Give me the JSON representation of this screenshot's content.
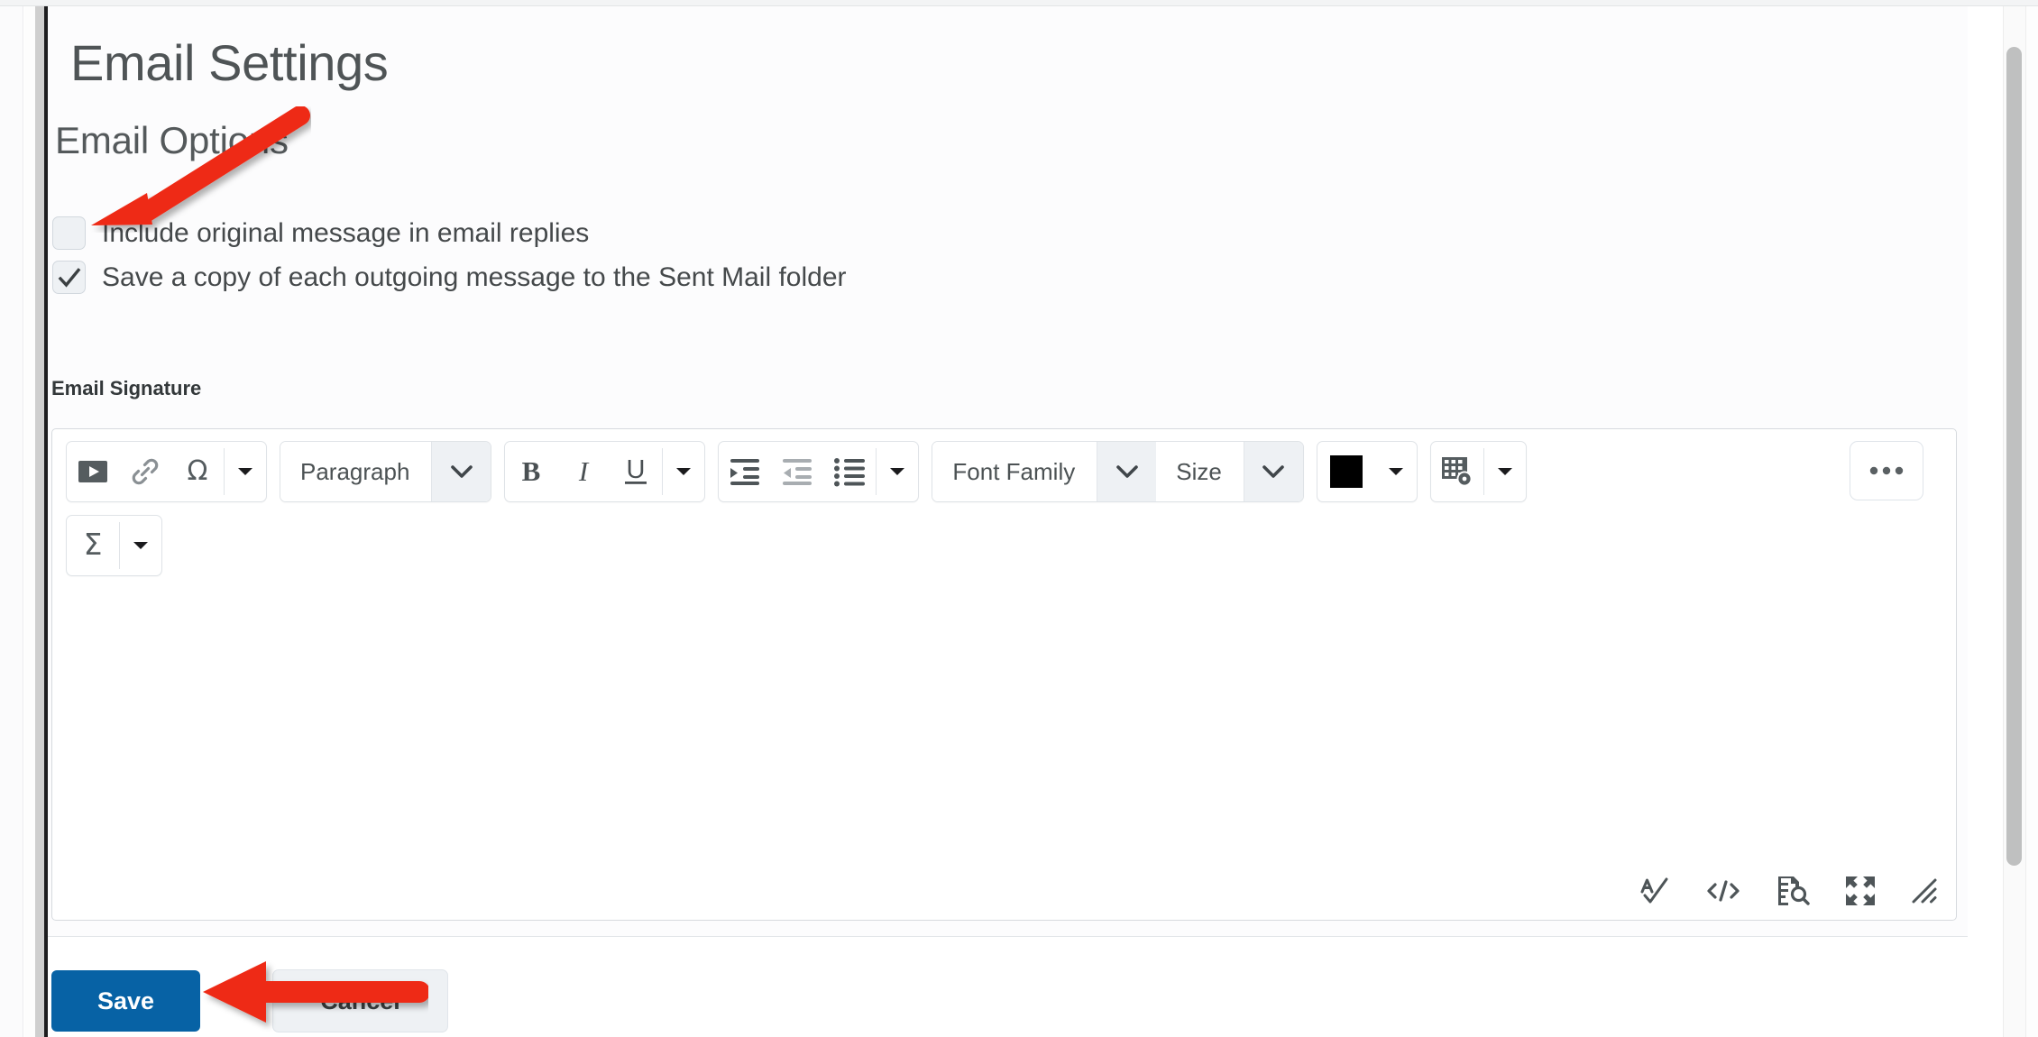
{
  "page": {
    "title": "Email Settings",
    "section_heading": "Email Options"
  },
  "options": [
    {
      "label": "Include original message in email replies",
      "checked": false,
      "name": "include-original-message"
    },
    {
      "label": "Save a copy of each outgoing message to the Sent Mail folder",
      "checked": true,
      "name": "save-copy-sent-mail"
    }
  ],
  "signature": {
    "field_label": "Email Signature",
    "body_text": ""
  },
  "toolbar": {
    "groups": [
      {
        "name": "insert-group",
        "items": [
          {
            "name": "insert-stuff-icon",
            "type": "icon",
            "icon": "insert-stuff"
          },
          {
            "name": "quicklink-icon",
            "type": "icon",
            "icon": "link"
          },
          {
            "name": "special-character-icon",
            "type": "icon",
            "icon": "omega"
          },
          {
            "name": "insert-more-caret",
            "type": "caret",
            "icon": "caret-down"
          }
        ]
      },
      {
        "name": "format-style-select",
        "value": "Paragraph",
        "caret": "caret-down"
      },
      {
        "name": "text-style-group",
        "items": [
          {
            "name": "bold-button",
            "type": "text",
            "label": "B",
            "icon": "bold"
          },
          {
            "name": "italic-button",
            "type": "text",
            "label": "I",
            "icon": "italic"
          },
          {
            "name": "underline-button",
            "type": "text",
            "label": "U",
            "icon": "underline"
          },
          {
            "name": "text-style-more-caret",
            "type": "caret",
            "icon": "caret-down"
          }
        ]
      },
      {
        "name": "paragraph-group",
        "items": [
          {
            "name": "indent-icon",
            "type": "icon",
            "icon": "indent",
            "enabled": true
          },
          {
            "name": "outdent-icon",
            "type": "icon",
            "icon": "outdent",
            "enabled": false
          },
          {
            "name": "bulleted-list-icon",
            "type": "icon",
            "icon": "bullet-list",
            "enabled": true
          },
          {
            "name": "paragraph-more-caret",
            "type": "caret",
            "icon": "caret-down"
          }
        ]
      },
      {
        "name": "font-group",
        "font_family": "Font Family",
        "font_size": "Size",
        "caret": "caret-down"
      },
      {
        "name": "color-group",
        "swatch_color": "#000000",
        "caret": "caret-down"
      },
      {
        "name": "table-group",
        "icon": "table-properties",
        "caret": "caret-down"
      },
      {
        "name": "more-options-button",
        "icon": "ellipsis",
        "label": "•••"
      },
      {
        "name": "equation-group",
        "icon": "sigma",
        "label": "Σ",
        "caret": "caret-down"
      }
    ]
  },
  "editor_status_bar": {
    "icons": [
      {
        "name": "spell-check-icon",
        "icon": "spell-check"
      },
      {
        "name": "html-source-icon",
        "icon": "html-source"
      },
      {
        "name": "accessibility-check-icon",
        "icon": "accessibility-check"
      },
      {
        "name": "fullscreen-icon",
        "icon": "fullscreen"
      },
      {
        "name": "resize-handle-icon",
        "icon": "resize-handle"
      }
    ]
  },
  "footer": {
    "save_label": "Save",
    "cancel_label": "Cancel"
  },
  "annotations": [
    {
      "name": "arrow-to-checkbox",
      "color": "#ee2a14",
      "points_to": "include-original-message-checkbox"
    },
    {
      "name": "arrow-to-cancel",
      "color": "#ee2a14",
      "points_to": "cancel-button"
    }
  ],
  "colors": {
    "accent_blue": "#0762a5",
    "annotation_red": "#ee2a14",
    "title_gray": "#4f5456",
    "swatch_black": "#000000"
  },
  "scrollbar": {
    "name": "vertical-scrollbar",
    "orientation": "vertical"
  }
}
